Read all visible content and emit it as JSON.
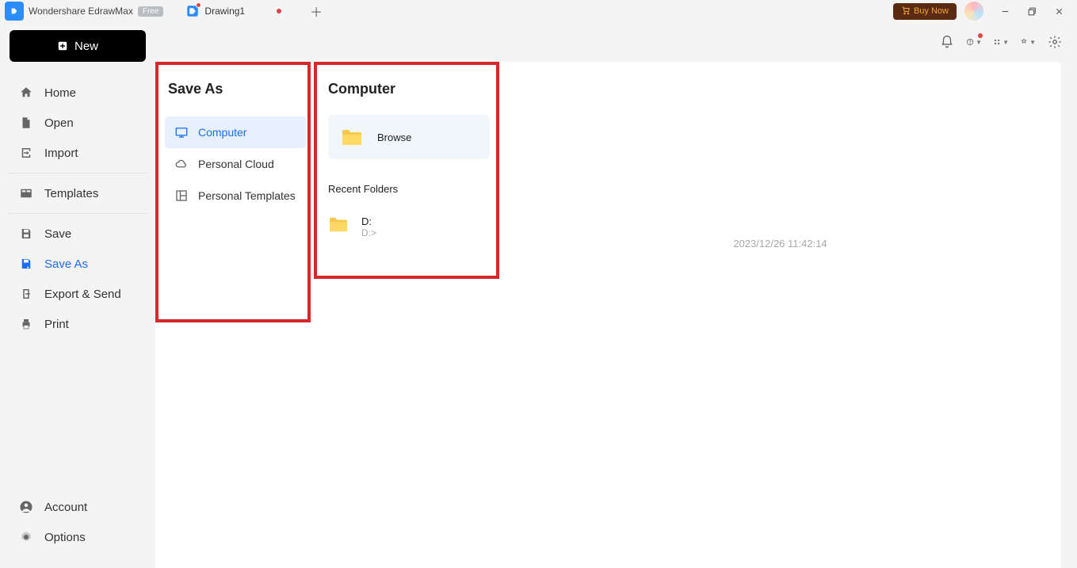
{
  "app": {
    "name": "Wondershare EdrawMax",
    "badge": "Free"
  },
  "tabs": [
    {
      "label": "Drawing1",
      "unsaved": true
    }
  ],
  "header_actions": {
    "buy_now": "Buy Now"
  },
  "new_button_label": "New",
  "sidebar": {
    "group1": [
      {
        "id": "home",
        "label": "Home",
        "icon": "home"
      },
      {
        "id": "open",
        "label": "Open",
        "icon": "file"
      },
      {
        "id": "import",
        "label": "Import",
        "icon": "import"
      }
    ],
    "group2": [
      {
        "id": "templates",
        "label": "Templates",
        "icon": "templates"
      }
    ],
    "group3": [
      {
        "id": "save",
        "label": "Save",
        "icon": "save"
      },
      {
        "id": "save-as",
        "label": "Save As",
        "icon": "save-as",
        "active": true
      },
      {
        "id": "export",
        "label": "Export & Send",
        "icon": "export"
      },
      {
        "id": "print",
        "label": "Print",
        "icon": "print"
      }
    ],
    "group_bottom": [
      {
        "id": "account",
        "label": "Account",
        "icon": "account"
      },
      {
        "id": "options",
        "label": "Options",
        "icon": "gear"
      }
    ]
  },
  "saveas_panel": {
    "title": "Save As",
    "locations": [
      {
        "id": "computer",
        "label": "Computer",
        "icon": "monitor",
        "selected": true
      },
      {
        "id": "cloud",
        "label": "Personal Cloud",
        "icon": "cloud"
      },
      {
        "id": "ptemplates",
        "label": "Personal Templates",
        "icon": "layout"
      }
    ]
  },
  "computer_panel": {
    "title": "Computer",
    "browse_label": "Browse",
    "recent_title": "Recent Folders",
    "recent_folders": [
      {
        "name": "D:",
        "path": "D:>"
      }
    ]
  },
  "canvas": {
    "timestamp": "2023/12/26 11:42:14"
  }
}
